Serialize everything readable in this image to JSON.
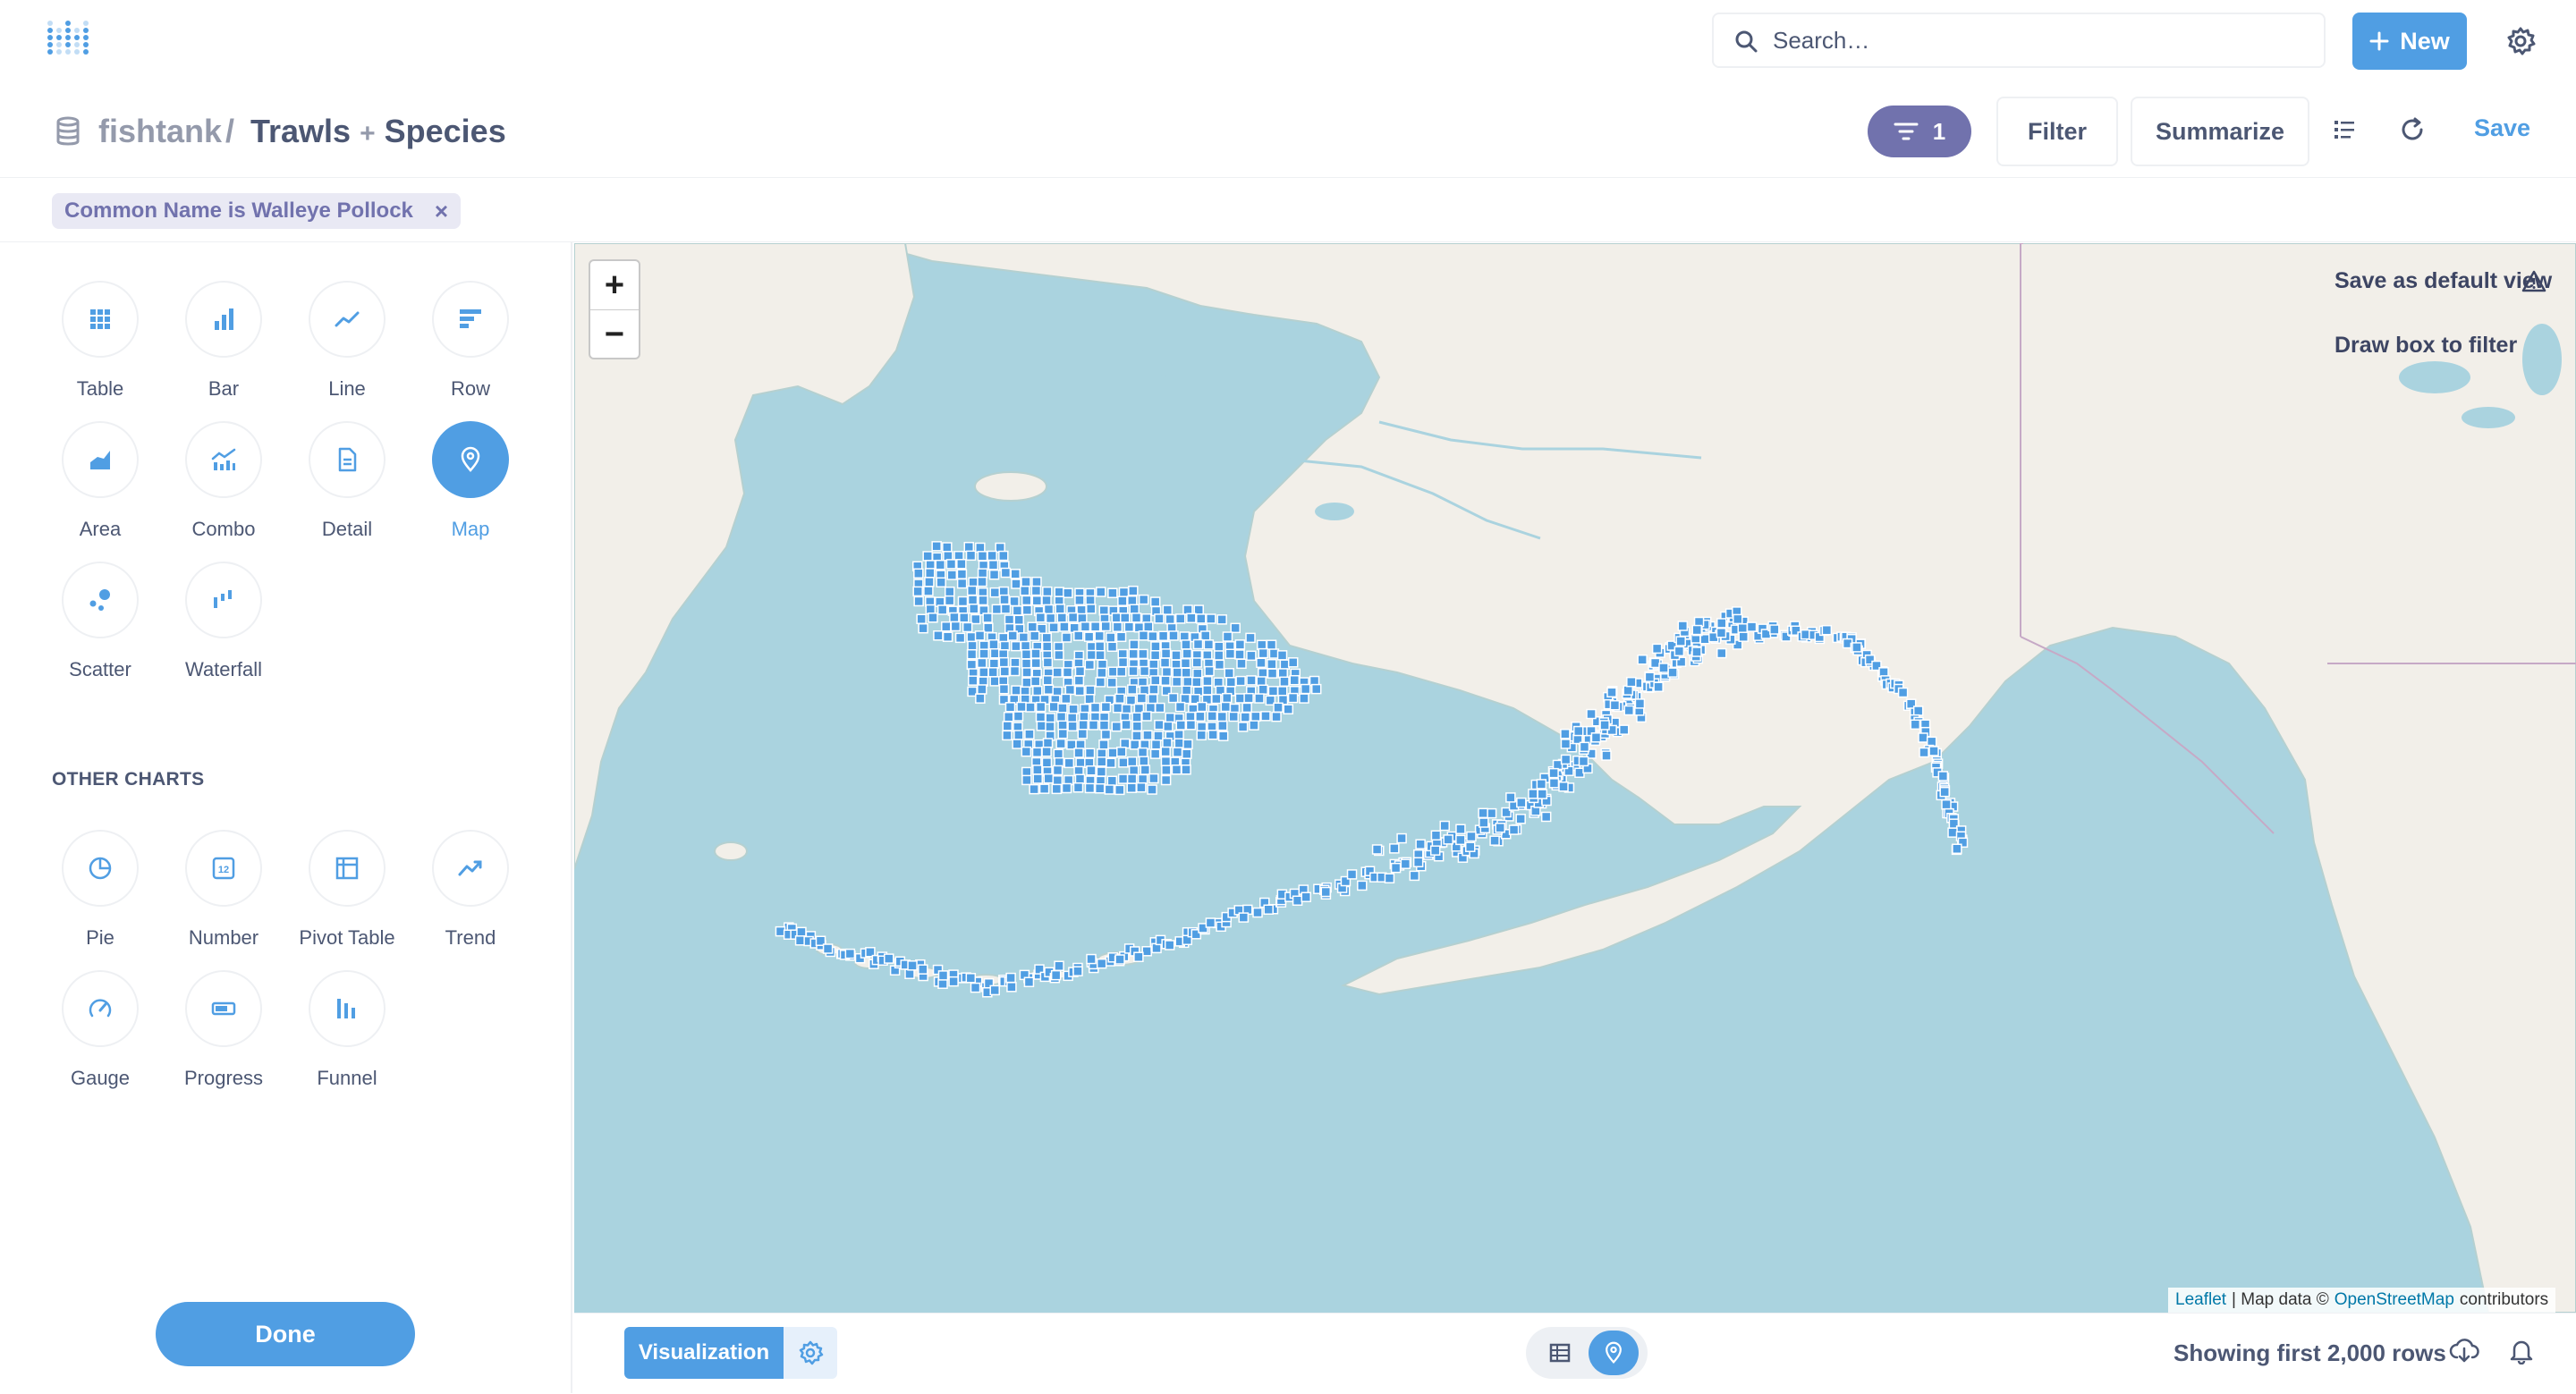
{
  "header": {
    "search_placeholder": "Search…",
    "new_label": "New",
    "breadcrumb_db": "fishtank",
    "breadcrumb_sep": "/",
    "title_a": "Trawls",
    "title_plus": "+",
    "title_b": "Species",
    "filter_count": "1",
    "filter_label": "Filter",
    "summarize_label": "Summarize",
    "save_label": "Save",
    "accent_color": "#509ee3",
    "filter_color": "#7172ad"
  },
  "active_filter": {
    "label": "Common Name is Walleye Pollock",
    "remove": "×"
  },
  "sidebar": {
    "main_charts": [
      {
        "label": "Table",
        "icon": "table-icon"
      },
      {
        "label": "Bar",
        "icon": "bar-chart-icon"
      },
      {
        "label": "Line",
        "icon": "line-chart-icon"
      },
      {
        "label": "Row",
        "icon": "row-chart-icon"
      },
      {
        "label": "Area",
        "icon": "area-chart-icon"
      },
      {
        "label": "Combo",
        "icon": "combo-chart-icon"
      },
      {
        "label": "Detail",
        "icon": "detail-icon"
      },
      {
        "label": "Map",
        "icon": "map-pin-icon",
        "selected": true
      },
      {
        "label": "Scatter",
        "icon": "scatter-icon"
      },
      {
        "label": "Waterfall",
        "icon": "waterfall-icon"
      }
    ],
    "other_heading": "OTHER CHARTS",
    "other_charts": [
      {
        "label": "Pie",
        "icon": "pie-icon"
      },
      {
        "label": "Number",
        "icon": "number-icon"
      },
      {
        "label": "Pivot Table",
        "icon": "pivot-table-icon"
      },
      {
        "label": "Trend",
        "icon": "trend-icon"
      },
      {
        "label": "Gauge",
        "icon": "gauge-icon"
      },
      {
        "label": "Progress",
        "icon": "progress-icon"
      },
      {
        "label": "Funnel",
        "icon": "funnel-icon"
      }
    ],
    "done_label": "Done"
  },
  "map": {
    "zoom_in": "+",
    "zoom_out": "−",
    "save_default_view": "Save as default view",
    "draw_box": "Draw box to filter",
    "attribution_leaflet": "Leaflet",
    "attribution_sep": "| Map data ©",
    "attribution_osm": "OpenStreetMap",
    "attribution_tail": "contributors",
    "water_color": "#aad3df",
    "land_color": "#f2efe9",
    "pin_color": "#509ee3"
  },
  "footer": {
    "visualization_label": "Visualization",
    "row_count": "Showing first 2,000 rows"
  }
}
